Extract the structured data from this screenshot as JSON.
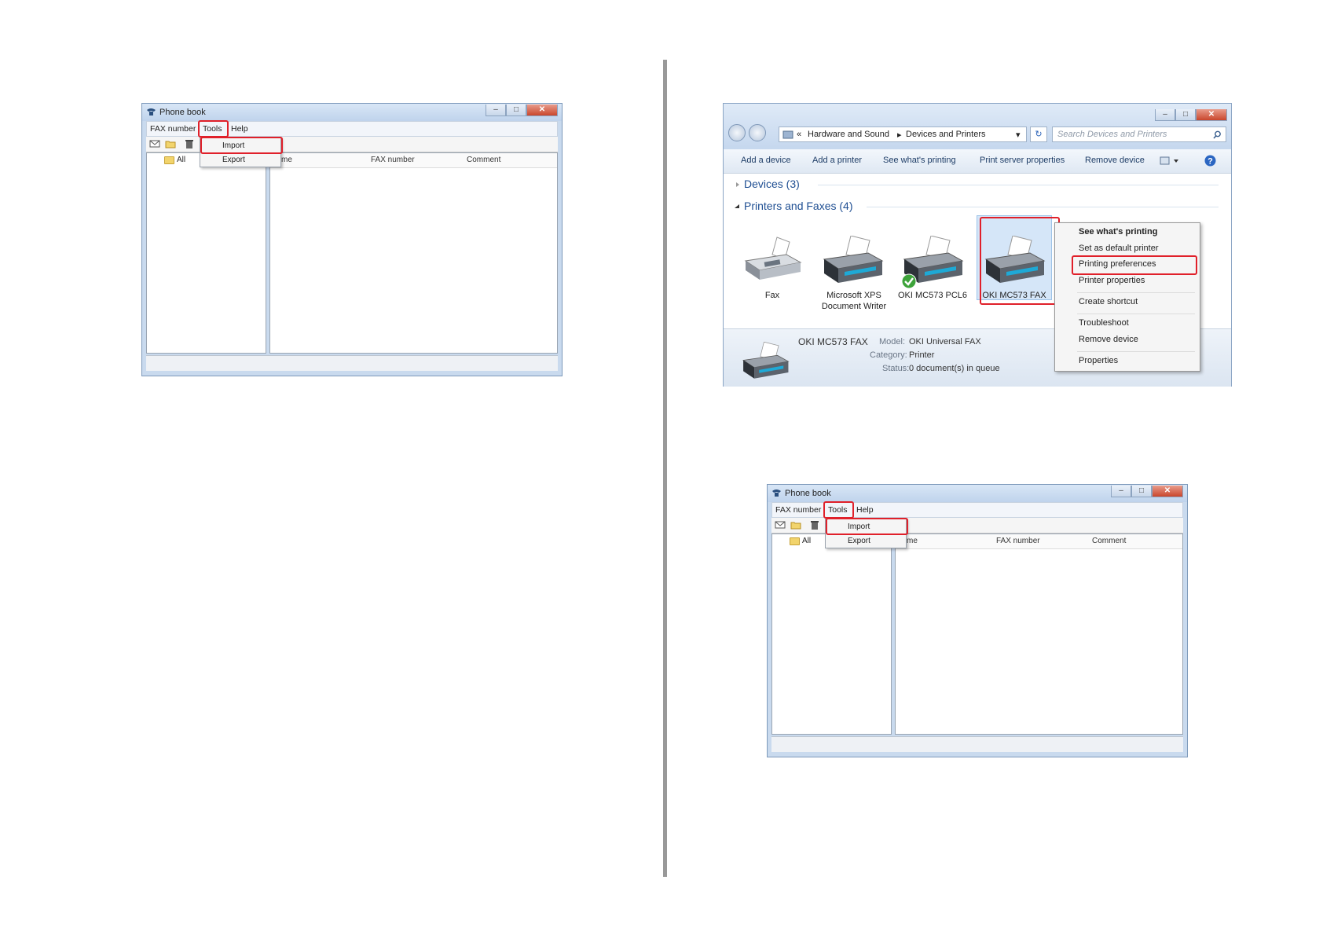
{
  "phonebook": {
    "title": "Phone book",
    "menu": [
      "FAX number",
      "Tools",
      "Help"
    ],
    "dropdown": [
      "Import",
      "Export"
    ],
    "tree_root": "All",
    "columns": [
      "me",
      "FAX number",
      "Comment"
    ],
    "window_buttons": [
      "–",
      "□",
      "✕"
    ]
  },
  "devices": {
    "breadcrumb": {
      "chevron": "«",
      "parts": [
        "Hardware and Sound",
        "Devices and Printers"
      ],
      "arrow": "▸",
      "dropdown_arrow": "▾"
    },
    "refresh": "↻",
    "search_placeholder": "Search Devices and Printers",
    "commands": [
      "Add a device",
      "Add a printer",
      "See what's printing",
      "Print server properties",
      "Remove device"
    ],
    "groups": [
      {
        "label": "Devices (3)",
        "expanded": false
      },
      {
        "label": "Printers and Faxes (4)",
        "expanded": true
      }
    ],
    "printers": [
      {
        "name": "Fax",
        "default": false
      },
      {
        "name": "Microsoft XPS Document Writer",
        "default": false
      },
      {
        "name": "OKI MC573 PCL6",
        "default": true
      },
      {
        "name": "OKI MC573 FAX",
        "default": false,
        "selected": true
      }
    ],
    "details": {
      "name": "OKI MC573 FAX",
      "model_label": "Model:",
      "model": "OKI Universal FAX",
      "category_label": "Category:",
      "category": "Printer",
      "status_label": "Status:",
      "status": "0 document(s) in queue"
    },
    "context_menu": [
      "See what's printing",
      "Set as default printer",
      "Printing preferences",
      "Printer properties",
      "Create shortcut",
      "Troubleshoot",
      "Remove device",
      "Properties"
    ]
  },
  "colors": {
    "highlight": "#e0202a",
    "link": "#1e4e92",
    "window_frame": "#c9daee"
  }
}
